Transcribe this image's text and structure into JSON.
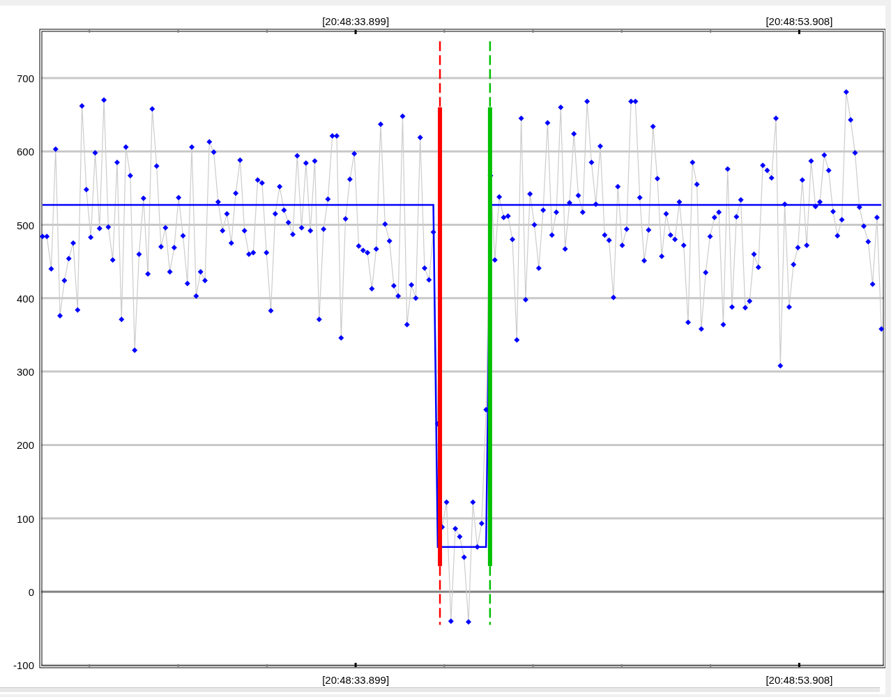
{
  "chart": {
    "chart_data": {
      "type": "line",
      "categories": [
        null,
        null,
        null,
        null,
        null,
        null,
        null,
        null,
        null,
        null,
        null,
        null,
        null,
        null,
        null,
        null,
        null,
        null,
        null,
        null,
        null,
        null,
        null,
        null,
        null,
        null,
        null,
        null,
        null,
        null,
        null,
        null,
        null,
        null,
        null,
        null,
        null,
        null,
        null,
        null,
        null,
        null,
        null,
        null,
        null,
        null,
        null,
        null,
        null,
        null,
        null,
        null,
        null,
        null,
        null,
        null,
        null,
        null,
        null,
        null,
        null,
        null,
        null,
        null,
        null,
        null,
        null,
        null,
        null,
        null,
        null,
        "[20:48:33.899]",
        null,
        null,
        null,
        null,
        null,
        null,
        null,
        null,
        null,
        null,
        null,
        null,
        null,
        null,
        null,
        null,
        null,
        null,
        null,
        null,
        null,
        null,
        null,
        null,
        null,
        null,
        null,
        null,
        null,
        null,
        null,
        null,
        null,
        null,
        null,
        null,
        null,
        null,
        null,
        null,
        null,
        null,
        null,
        null,
        null,
        null,
        null,
        null,
        null,
        null,
        null,
        null,
        null,
        null,
        null,
        null,
        null,
        null,
        null,
        null,
        null,
        null,
        null,
        null,
        null,
        null,
        null,
        null,
        null,
        null,
        null,
        null,
        null,
        null,
        null,
        null,
        null,
        null,
        null,
        null,
        null,
        null,
        null,
        null,
        null,
        null,
        null,
        null,
        null,
        null,
        null,
        null,
        null,
        null,
        null,
        null,
        null,
        null,
        null,
        null,
        "[20:48:53.908]",
        null,
        null,
        null,
        null,
        null,
        null,
        null,
        null,
        null,
        null,
        null,
        null,
        null,
        null,
        null,
        null,
        null,
        null,
        null
      ],
      "series": [
        {
          "color": "#0000ff",
          "marker": true,
          "values": [
            484,
            484,
            440,
            603,
            376,
            424,
            454,
            475,
            384,
            662,
            548,
            483,
            598,
            495,
            670,
            497,
            452,
            585,
            371,
            606,
            567,
            329,
            460,
            536,
            433,
            658,
            580,
            470,
            496,
            436,
            469,
            537,
            485,
            420,
            606,
            403,
            436,
            424,
            613,
            599,
            531,
            492,
            515,
            475,
            543,
            588,
            492,
            460,
            462,
            561,
            557,
            462,
            383,
            515,
            552,
            520,
            503,
            487,
            594,
            496,
            584,
            492,
            587,
            371,
            494,
            535,
            621,
            621,
            346,
            508,
            562,
            597,
            471,
            465,
            462,
            413,
            467,
            637,
            501,
            478,
            417,
            403,
            648,
            364,
            418,
            400,
            619,
            441,
            425,
            490,
            229,
            88,
            122,
            -40,
            86,
            75,
            47,
            -41,
            122,
            61,
            93,
            248,
            567,
            452,
            538,
            510,
            512,
            480,
            343,
            645,
            398,
            542,
            500,
            441,
            520,
            639,
            486,
            517,
            660,
            467,
            530,
            624,
            540,
            517,
            668,
            585,
            528,
            607,
            486,
            479,
            401,
            552,
            472,
            494,
            668,
            668,
            537,
            451,
            493,
            634,
            563,
            457,
            515,
            486,
            480,
            531,
            472,
            367,
            585,
            555,
            358,
            435,
            484,
            510,
            517,
            364,
            576,
            388,
            511,
            534,
            387,
            396,
            460,
            442,
            581,
            574,
            564,
            645,
            308,
            528,
            388,
            446,
            469,
            561,
            472,
            587,
            525,
            531,
            595,
            574,
            518,
            485,
            507,
            681,
            643,
            598,
            524,
            498,
            477,
            419,
            510,
            358
          ]
        },
        {
          "color": "#0000ff",
          "values": [
            527,
            527,
            527,
            527,
            527,
            527,
            527,
            527,
            527,
            527,
            527,
            527,
            527,
            527,
            527,
            527,
            527,
            527,
            527,
            527,
            527,
            527,
            527,
            527,
            527,
            527,
            527,
            527,
            527,
            527,
            527,
            527,
            527,
            527,
            527,
            527,
            527,
            527,
            527,
            527,
            527,
            527,
            527,
            527,
            527,
            527,
            527,
            527,
            527,
            527,
            527,
            527,
            527,
            527,
            527,
            527,
            527,
            527,
            527,
            527,
            527,
            527,
            527,
            527,
            527,
            527,
            527,
            527,
            527,
            527,
            527,
            527,
            527,
            527,
            527,
            527,
            527,
            527,
            527,
            527,
            527,
            527,
            527,
            527,
            527,
            527,
            527,
            527,
            527,
            527,
            61,
            61,
            61,
            61,
            61,
            61,
            61,
            61,
            61,
            61,
            61,
            61,
            527,
            527,
            527,
            527,
            527,
            527,
            527,
            527,
            527,
            527,
            527,
            527,
            527,
            527,
            527,
            527,
            527,
            527,
            527,
            527,
            527,
            527,
            527,
            527,
            527,
            527,
            527,
            527,
            527,
            527,
            527,
            527,
            527,
            527,
            527,
            527,
            527,
            527,
            527,
            527,
            527,
            527,
            527,
            527,
            527,
            527,
            527,
            527,
            527,
            527,
            527,
            527,
            527,
            527,
            527,
            527,
            527,
            527,
            527,
            527,
            527,
            527,
            527,
            527,
            527,
            527,
            527,
            527,
            527,
            527,
            527,
            527,
            527,
            527,
            527,
            527,
            527,
            527,
            527,
            527,
            527,
            527,
            527,
            527,
            527,
            527,
            527,
            527,
            527,
            527
          ]
        }
      ],
      "ylim": [
        -101.6,
        764.5
      ],
      "yticks": [
        -100,
        0,
        100,
        200,
        300,
        400,
        500,
        600,
        700
      ],
      "grid": true
    }
  }
}
